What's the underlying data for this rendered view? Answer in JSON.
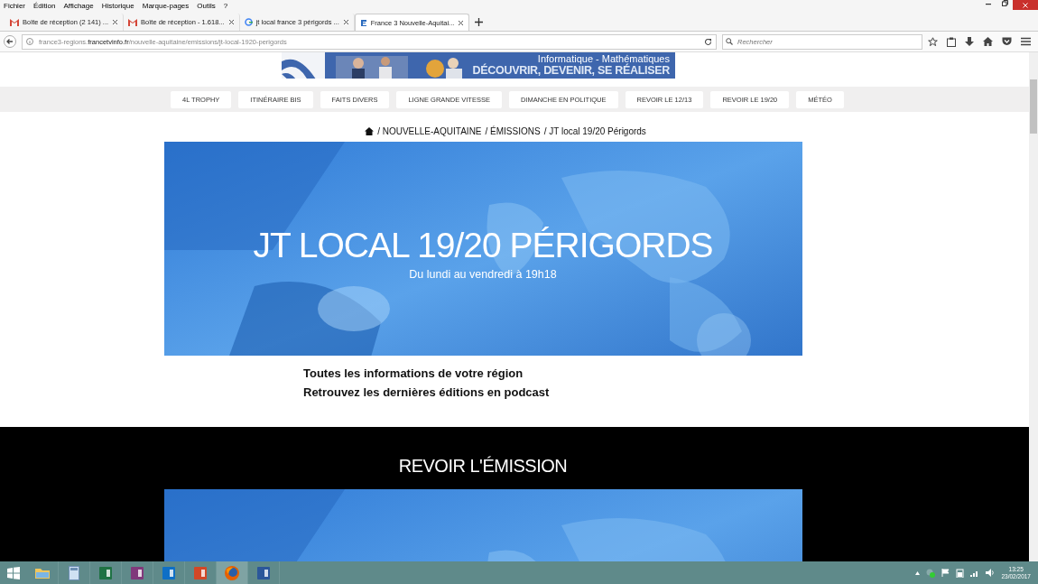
{
  "menu_bar": [
    "Fichier",
    "Édition",
    "Affichage",
    "Historique",
    "Marque-pages",
    "Outils",
    "?"
  ],
  "tabs": [
    {
      "title": "Boîte de réception (2 141) ...",
      "selected": false
    },
    {
      "title": "Boîte de réception - 1.618...",
      "selected": false
    },
    {
      "title": "jt local france 3 périgords ...",
      "selected": false
    },
    {
      "title": "France 3 Nouvelle-Aquitai...",
      "selected": true
    }
  ],
  "address": {
    "host_before": "france3-regions.",
    "host": "francetvinfo.fr",
    "path": "/nouvelle-aquitaine/emissions/jt-local-1920-perigords"
  },
  "search": {
    "placeholder": "Rechercher"
  },
  "banner": {
    "line_1": "Informatique - Mathématiques",
    "line_2": "DÉCOUVRIR, DEVENIR, SE RÉALISER"
  },
  "nav": [
    "4L TROPHY",
    "ITINÉRAIRE BIS",
    "FAITS DIVERS",
    "LIGNE GRANDE VITESSE",
    "DIMANCHE EN POLITIQUE",
    "REVOIR LE 12/13",
    "REVOIR LE 19/20",
    "MÉTÉO"
  ],
  "breadcrumb": [
    "/ NOUVELLE-AQUITAINE",
    "/ ÉMISSIONS",
    "/ JT local 19/20 Périgords"
  ],
  "hero": {
    "title": "JT LOCAL 19/20 PÉRIGORDS",
    "subtitle": "Du lundi au vendredi à 19h18"
  },
  "intro": [
    "Toutes les informations de votre région",
    "Retrouvez les dernières éditions en podcast"
  ],
  "replay": {
    "heading": "REVOIR L'ÉMISSION"
  },
  "taskbar": [
    {
      "selected": false
    },
    {
      "selected": false
    },
    {
      "selected": false
    },
    {
      "selected": false
    },
    {
      "selected": false
    },
    {
      "selected": false
    },
    {
      "selected": true
    },
    {
      "selected": false
    }
  ],
  "clock": {
    "time": "13:25",
    "date": "23/02/2017"
  }
}
